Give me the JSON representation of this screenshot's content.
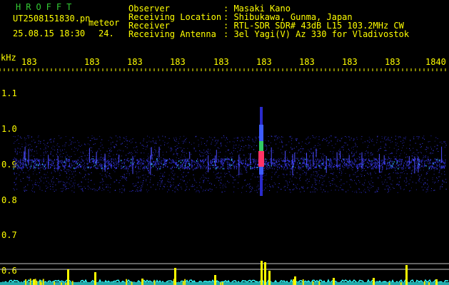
{
  "header": {
    "program": "HROFFT",
    "filename": "UT2508151830.pn",
    "filetype": "meteor",
    "datetime": "25.08.15 18:30",
    "gain_value": "24.",
    "info": [
      {
        "label": "Observer",
        "value": ": Masaki Kano"
      },
      {
        "label": "Receiving Location",
        "value": ": Shibukawa, Gunma, Japan"
      },
      {
        "label": "Receiver",
        "value": ": RTL-SDR SDR# 43dB L15 103.2MHz CW"
      },
      {
        "label": "Receiving Antenna",
        "value": ": 3el Yagi(V) Az 330 for Vladivostok"
      }
    ]
  },
  "axes": {
    "y_unit": "kHz",
    "y_ticks": [
      "1.1",
      "1.0",
      "0.9",
      "0.8",
      "0.7",
      "0.6"
    ],
    "x_ticks": [
      "183",
      "183",
      "183",
      "183",
      "183",
      "183",
      "183",
      "183",
      "183",
      "1840"
    ]
  },
  "colors": {
    "text": "#ffff00",
    "title": "#33cc33",
    "baseline": "#33ffff",
    "meteor": "#ff3366"
  }
}
